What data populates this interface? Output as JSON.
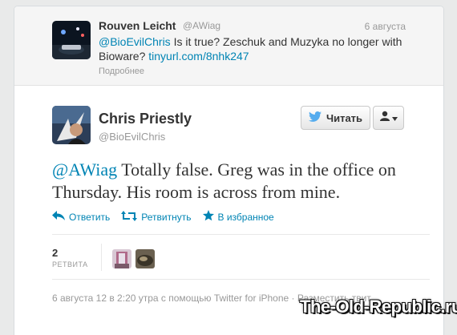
{
  "previous_tweet": {
    "name": "Rouven Leicht",
    "handle": "@AWiag",
    "date": "6 августа",
    "mention": "@BioEvilChris",
    "text": " Is it true? Zeschuk and Muzyka no longer with Bioware? ",
    "link": "tinyurl.com/8nhk247",
    "details_label": "Подробнее"
  },
  "tweet": {
    "name": "Chris Priestly",
    "handle": "@BioEvilChris",
    "mention": "@AWiag",
    "text": " Totally false. Greg was in the office on Thursday. His room is across from mine.",
    "follow_label": "Читать",
    "actions": {
      "reply": "Ответить",
      "retweet": "Ретвитнуть",
      "favorite": "В избранное"
    },
    "retweet_count": "2",
    "retweet_label": "РЕТВИТА",
    "meta": "6 августа 12 в 2:20 утра с помощью Twitter for iPhone · Разместить твит"
  },
  "watermark": "The-Old-Republic.ru",
  "colors": {
    "link": "#0084b4",
    "twitter_bird": "#55acee"
  }
}
